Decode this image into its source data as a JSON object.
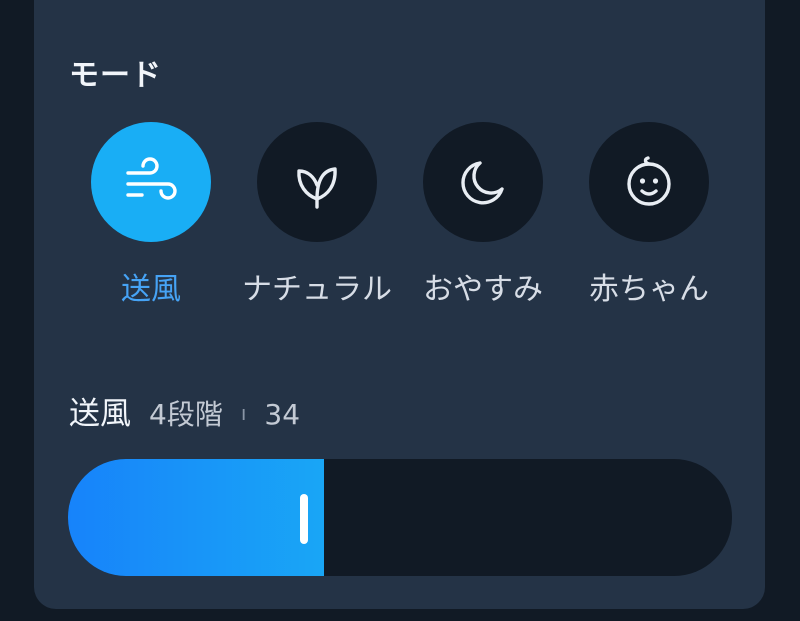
{
  "section_title": "モード",
  "modes": [
    {
      "label": "送風",
      "icon": "wind-icon",
      "active": true
    },
    {
      "label": "ナチュラル",
      "icon": "leaf-icon",
      "active": false
    },
    {
      "label": "おやすみ",
      "icon": "moon-icon",
      "active": false
    },
    {
      "label": "赤ちゃん",
      "icon": "baby-face-icon",
      "active": false
    }
  ],
  "level": {
    "mode_label": "送風",
    "step_label": "4段階",
    "separator": "ı",
    "value": "34"
  },
  "slider": {
    "fill_percent": 38.5,
    "handle_percent": 35.5
  },
  "colors": {
    "background": "#111a25",
    "panel": "#243346",
    "accent": "#19aef5",
    "accent_text": "#46a3f5",
    "slider_fill_start": "#1783fa",
    "slider_fill_end": "#19a6f6"
  }
}
